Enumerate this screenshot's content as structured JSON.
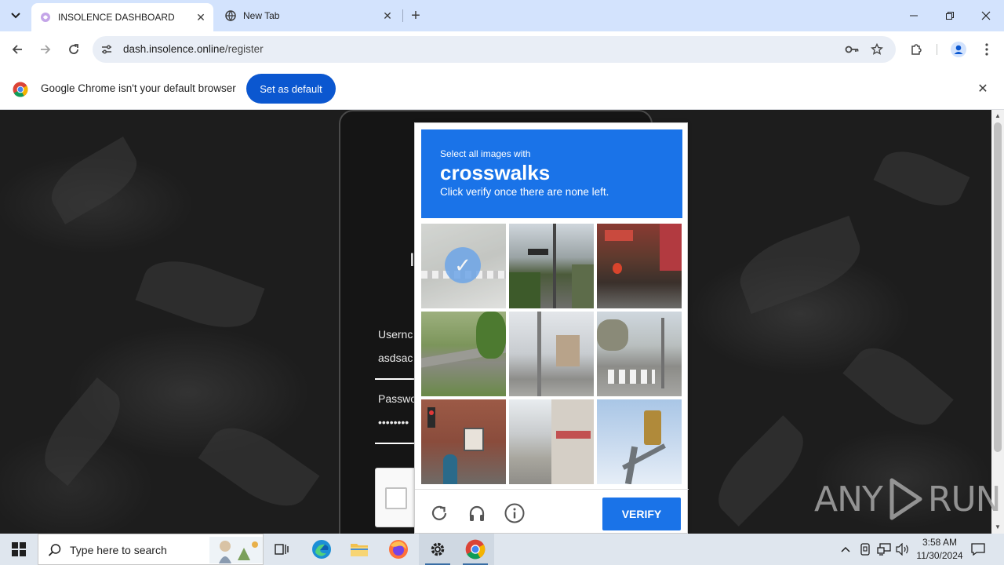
{
  "browser": {
    "tabs": [
      {
        "title": "INSOLENCE DASHBOARD",
        "active": true
      },
      {
        "title": "New Tab",
        "active": false
      }
    ],
    "address": {
      "host": "dash.insolence.online",
      "path": "/register"
    },
    "infobar": {
      "message": "Google Chrome isn't your default browser",
      "button": "Set as default"
    }
  },
  "page": {
    "heading": "I",
    "username_label": "Usernc",
    "username_value": "asdsac",
    "password_label": "Passwo",
    "password_value": "••••••••"
  },
  "captcha": {
    "instruction": "Select all images with",
    "target": "crosswalks",
    "note": "Click verify once there are none left.",
    "verify_label": "VERIFY",
    "tiles": [
      {
        "name": "tile-1",
        "selected": true
      },
      {
        "name": "tile-2",
        "selected": false
      },
      {
        "name": "tile-3",
        "selected": false
      },
      {
        "name": "tile-4",
        "selected": false
      },
      {
        "name": "tile-5",
        "selected": false
      },
      {
        "name": "tile-6",
        "selected": false
      },
      {
        "name": "tile-7",
        "selected": false
      },
      {
        "name": "tile-8",
        "selected": false
      },
      {
        "name": "tile-9",
        "selected": false
      }
    ]
  },
  "watermark": {
    "text": "ANY",
    "text2": "RUN"
  },
  "taskbar": {
    "search_placeholder": "Type here to search",
    "time": "3:58 AM",
    "date": "11/30/2024"
  },
  "colors": {
    "accent": "#1a73e8",
    "chrome_blue": "#0b57d0",
    "tabstrip": "#d3e3fd"
  }
}
